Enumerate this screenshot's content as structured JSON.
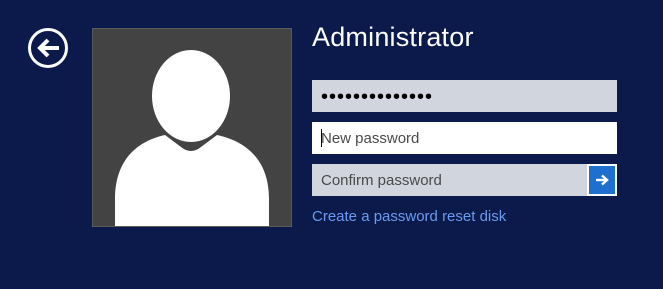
{
  "user": {
    "name": "Administrator"
  },
  "fields": {
    "current_password": {
      "value": "••••••••••••••"
    },
    "new_password": {
      "placeholder": "New password",
      "value": ""
    },
    "confirm_password": {
      "placeholder": "Confirm password",
      "value": ""
    }
  },
  "links": {
    "reset_disk": "Create a password reset disk"
  },
  "icons": {
    "back": "back-arrow-circle-icon",
    "submit": "right-arrow-icon",
    "avatar": "user-silhouette-icon"
  },
  "colors": {
    "background": "#0b1a4a",
    "avatar_bg": "#434343",
    "field_gray": "#d1d5de",
    "accent_blue": "#1f6fd0",
    "link": "#6a9bf0"
  }
}
